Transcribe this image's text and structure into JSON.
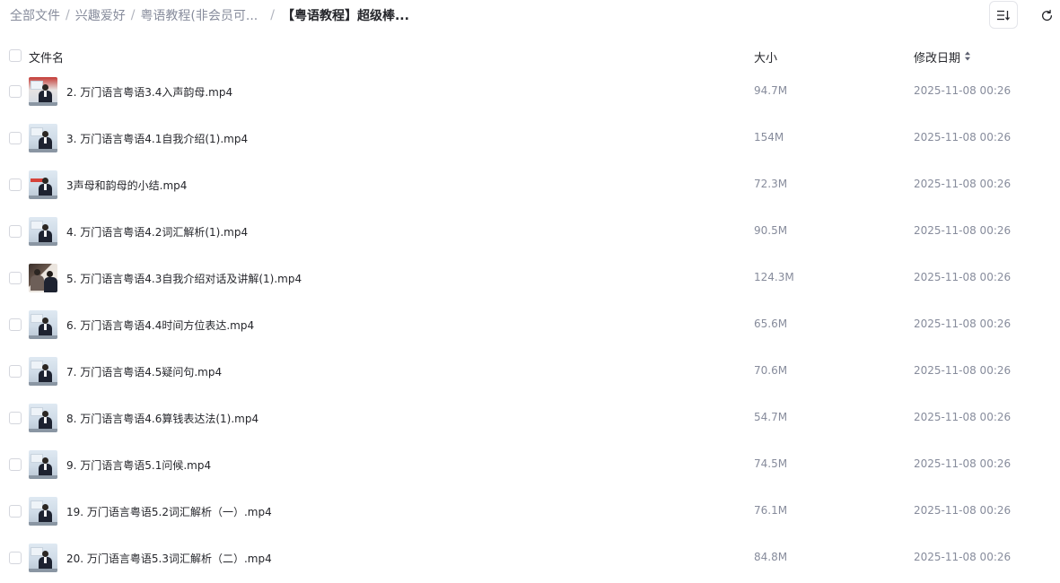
{
  "breadcrumb": {
    "items": [
      "全部文件",
      "兴趣爱好",
      "粤语教程(非会员可...",
      "【粤语教程】超级棒..."
    ],
    "separator": "/"
  },
  "toolbar": {
    "sort_icon": "sort-list-icon",
    "refresh_icon": "refresh-icon"
  },
  "table": {
    "headers": {
      "name": "文件名",
      "size": "大小",
      "modified": "修改日期"
    },
    "sort_icon": "sort-updown-icon",
    "rows": [
      {
        "name": "2. 万门语言粤语3.4入声韵母.mp4",
        "size": "94.7M",
        "modified": "2025-11-08 00:26"
      },
      {
        "name": "3. 万门语言粤语4.1自我介绍(1).mp4",
        "size": "154M",
        "modified": "2025-11-08 00:26"
      },
      {
        "name": "3声母和韵母的小结.mp4",
        "size": "72.3M",
        "modified": "2025-11-08 00:26"
      },
      {
        "name": "4. 万门语言粤语4.2词汇解析(1).mp4",
        "size": "90.5M",
        "modified": "2025-11-08 00:26"
      },
      {
        "name": "5. 万门语言粤语4.3自我介绍对话及讲解(1).mp4",
        "size": "124.3M",
        "modified": "2025-11-08 00:26"
      },
      {
        "name": "6. 万门语言粤语4.4时间方位表达.mp4",
        "size": "65.6M",
        "modified": "2025-11-08 00:26"
      },
      {
        "name": "7. 万门语言粤语4.5疑问句.mp4",
        "size": "70.6M",
        "modified": "2025-11-08 00:26"
      },
      {
        "name": "8. 万门语言粤语4.6算钱表达法(1).mp4",
        "size": "54.7M",
        "modified": "2025-11-08 00:26"
      },
      {
        "name": "9. 万门语言粤语5.1问候.mp4",
        "size": "74.5M",
        "modified": "2025-11-08 00:26"
      },
      {
        "name": "19. 万门语言粤语5.2词汇解析（一）.mp4",
        "size": "76.1M",
        "modified": "2025-11-08 00:26"
      },
      {
        "name": "20. 万门语言粤语5.3词汇解析（二）.mp4",
        "size": "84.8M",
        "modified": "2025-11-08 00:26"
      }
    ]
  }
}
